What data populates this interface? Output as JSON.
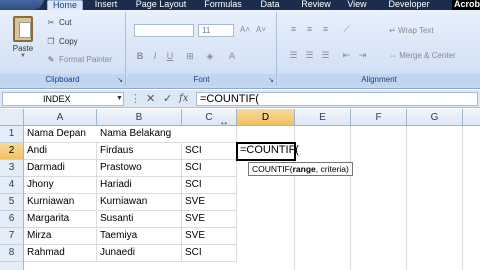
{
  "ribbon_tabs": [
    "Home",
    "Insert",
    "Page Layout",
    "Formulas",
    "Data",
    "Review",
    "View",
    "Developer"
  ],
  "acrobat_tab": "Acrob",
  "clipboard": {
    "paste_label": "Paste",
    "cut_label": "Cut",
    "copy_label": "Copy",
    "format_painter_label": "Format Painter",
    "group_label": "Clipboard"
  },
  "font": {
    "group_label": "Font",
    "size": "11",
    "bold": "B",
    "italic": "I",
    "underline": "U",
    "grow": "A˄",
    "shrink": "A˅"
  },
  "alignment": {
    "group_label": "Alignment",
    "wrap_text_label": "Wrap Text",
    "merge_center_label": "Merge & Center"
  },
  "formula_bar": {
    "name_box": "INDEX",
    "cancel": "✕",
    "enter": "✓",
    "fx": "fx",
    "formula": "=COUNTIF("
  },
  "columns": [
    "A",
    "B",
    "C",
    "D",
    "E",
    "F",
    "G"
  ],
  "rows": [
    {
      "num": "1",
      "a": "Nama Depan",
      "b": "Nama Belakang",
      "c": ""
    },
    {
      "num": "2",
      "a": "Andi",
      "b": "Firdaus",
      "c": "SCI"
    },
    {
      "num": "3",
      "a": "Darmadi",
      "b": "Prastowo",
      "c": "SCI"
    },
    {
      "num": "4",
      "a": "Jhony",
      "b": "Hariadi",
      "c": "SCI"
    },
    {
      "num": "5",
      "a": "Kurniawan",
      "b": "Kurniawan",
      "c": "SVE"
    },
    {
      "num": "6",
      "a": "Margarita",
      "b": "Susanti",
      "c": "SVE"
    },
    {
      "num": "7",
      "a": "Mirza",
      "b": "Taemiya",
      "c": "SVE"
    },
    {
      "num": "8",
      "a": "Rahmad",
      "b": "Junaedi",
      "c": "SCI"
    }
  ],
  "active_cell_text": "=COUNTIF(",
  "tooltip": {
    "func": "COUNTIF(",
    "arg1": "range",
    "rest": ", criteria)"
  }
}
